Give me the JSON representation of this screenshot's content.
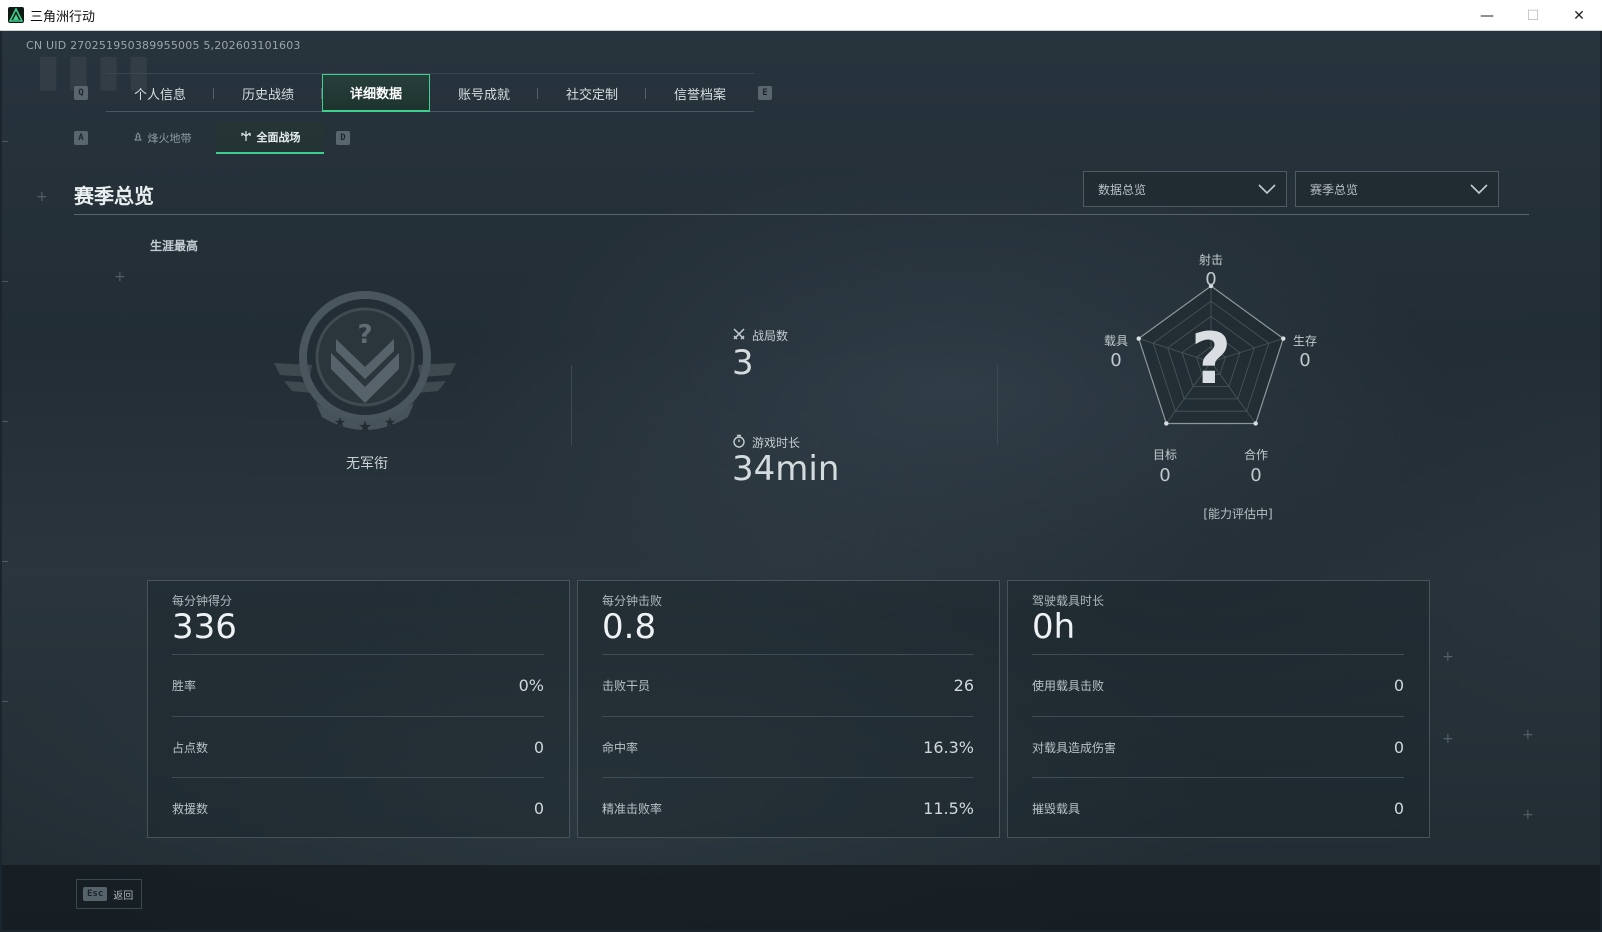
{
  "window": {
    "title": "三角洲行动",
    "minimize": "—",
    "maximize": "☐",
    "close": "✕"
  },
  "header": {
    "uid": "CN UID 270251950389955005 5,202603101603"
  },
  "tabs": {
    "prev_key": "Q",
    "next_key": "E",
    "items": [
      {
        "label": "个人信息"
      },
      {
        "label": "历史战绩"
      },
      {
        "label": "详细数据",
        "active": true
      },
      {
        "label": "账号成就"
      },
      {
        "label": "社交定制"
      },
      {
        "label": "信誉档案"
      }
    ]
  },
  "subtabs": {
    "prev_key": "A",
    "next_key": "D",
    "items": [
      {
        "label": "烽火地带",
        "icon": "fire-zone-icon"
      },
      {
        "label": "全面战场",
        "icon": "battlefield-icon",
        "active": true
      }
    ]
  },
  "section": {
    "title": "赛季总览",
    "dropdown_data": "数据总览",
    "dropdown_season": "赛季总览"
  },
  "career": {
    "label": "生涯最高",
    "rank_icon": "rank-unknown-icon",
    "rank_name": "无军衔"
  },
  "summary": {
    "matches_label": "战局数",
    "matches_value": "3",
    "playtime_label": "游戏时长",
    "playtime_value": "34min"
  },
  "radar": {
    "center_mark": "?",
    "status": "[能力评估中]",
    "axes": [
      {
        "label": "射击",
        "value": "0"
      },
      {
        "label": "生存",
        "value": "0"
      },
      {
        "label": "合作",
        "value": "0"
      },
      {
        "label": "目标",
        "value": "0"
      },
      {
        "label": "载具",
        "value": "0"
      }
    ]
  },
  "cards": [
    {
      "title": "每分钟得分",
      "value": "336",
      "rows": [
        {
          "label": "胜率",
          "value": "0%"
        },
        {
          "label": "占点数",
          "value": "0"
        },
        {
          "label": "救援数",
          "value": "0"
        }
      ]
    },
    {
      "title": "每分钟击败",
      "value": "0.8",
      "rows": [
        {
          "label": "击败干员",
          "value": "26"
        },
        {
          "label": "命中率",
          "value": "16.3%"
        },
        {
          "label": "精准击败率",
          "value": "11.5%"
        }
      ]
    },
    {
      "title": "驾驶载具时长",
      "value": "0h",
      "rows": [
        {
          "label": "使用载具击败",
          "value": "0"
        },
        {
          "label": "对载具造成伤害",
          "value": "0"
        },
        {
          "label": "摧毁载具",
          "value": "0"
        }
      ]
    }
  ],
  "footer": {
    "esc_key": "Esc",
    "back_label": "返回"
  },
  "colors": {
    "accent": "#3fcf8e",
    "background": "#222d35",
    "text": "#c9d3d8"
  }
}
